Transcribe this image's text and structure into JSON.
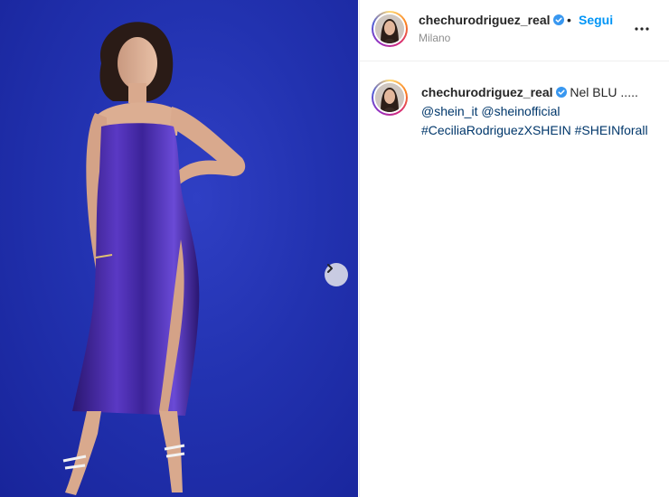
{
  "post": {
    "username": "chechurodriguez_real",
    "verified": true,
    "follow_label": "Segui",
    "separator": "•",
    "location": "Milano",
    "more_icon": "more-horizontal-icon"
  },
  "caption": {
    "username": "chechurodriguez_real",
    "text": "Nel BLU .....",
    "mentions": [
      "@shein_it",
      "@sheinofficial"
    ],
    "hashtags": [
      "#CeciliaRodriguezXSHEIN",
      "#SHEINforall"
    ]
  },
  "media": {
    "background_color": "#2232b0",
    "dress_color": "#3a1f8f",
    "next_icon": "chevron-right-icon"
  },
  "colors": {
    "link_blue": "#0095f6",
    "hashtag_blue": "#00376b",
    "verified_blue": "#3897f0",
    "muted_text": "#8e8e8e"
  }
}
